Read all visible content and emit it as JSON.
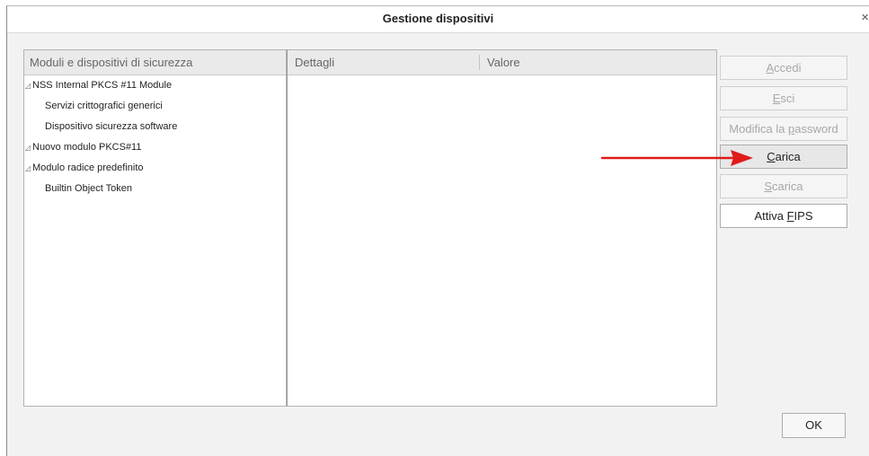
{
  "window": {
    "title": "Gestione dispositivi",
    "close_glyph": "×"
  },
  "tree": {
    "header": "Moduli e dispositivi di sicurezza",
    "items": [
      {
        "label": "NSS Internal PKCS #11 Module",
        "level": 0,
        "twisty": "◿"
      },
      {
        "label": "Servizi crittografici generici",
        "level": 1
      },
      {
        "label": "Dispositivo sicurezza software",
        "level": 1
      },
      {
        "label": "Nuovo modulo PKCS#11",
        "level": 0,
        "twisty": "◿"
      },
      {
        "label": "Modulo radice predefinito",
        "level": 0,
        "twisty": "◿"
      },
      {
        "label": "Builtin Object Token",
        "level": 1
      }
    ]
  },
  "details": {
    "col_details": "Dettagli",
    "col_value": "Valore"
  },
  "buttons": {
    "accedi": {
      "pre": "",
      "key": "A",
      "post": "ccedi",
      "enabled": false
    },
    "esci": {
      "pre": "",
      "key": "E",
      "post": "sci",
      "enabled": false
    },
    "modifica_password": {
      "pre": "Modifica la ",
      "key": "p",
      "post": "assword",
      "enabled": false
    },
    "carica": {
      "pre": "",
      "key": "C",
      "post": "arica",
      "enabled": true
    },
    "scarica": {
      "pre": "",
      "key": "S",
      "post": "carica",
      "enabled": false
    },
    "attiva_fips": {
      "pre": "Attiva ",
      "key": "F",
      "post": "IPS",
      "enabled": true
    },
    "ok": "OK"
  },
  "annotation": {
    "arrow_color": "#e01b1b"
  }
}
